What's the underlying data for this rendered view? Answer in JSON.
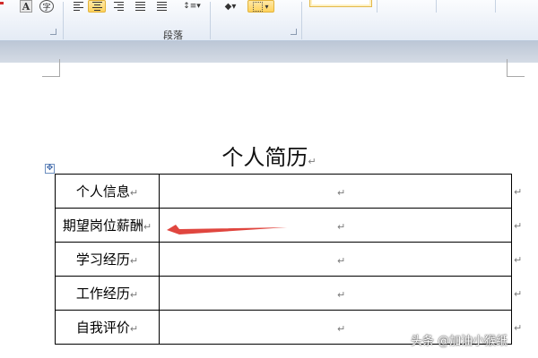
{
  "ribbon": {
    "font_group_glyphs": [
      "A",
      "字"
    ],
    "paragraph_group_label": "段落",
    "shading_icon": "paint-bucket-icon",
    "border_icon": "border-grid-icon",
    "style_preview": "",
    "highlight_color": "#ffd25c"
  },
  "document": {
    "title": "个人简历",
    "paragraph_mark": "↵",
    "rows": [
      {
        "label": "个人信息"
      },
      {
        "label": "期望岗位薪酬"
      },
      {
        "label": "学习经历"
      },
      {
        "label": "工作经历"
      },
      {
        "label": "自我评价"
      }
    ],
    "annotation_arrow_color": "#e0463f"
  },
  "watermark": "头条 @加油小猴纸"
}
